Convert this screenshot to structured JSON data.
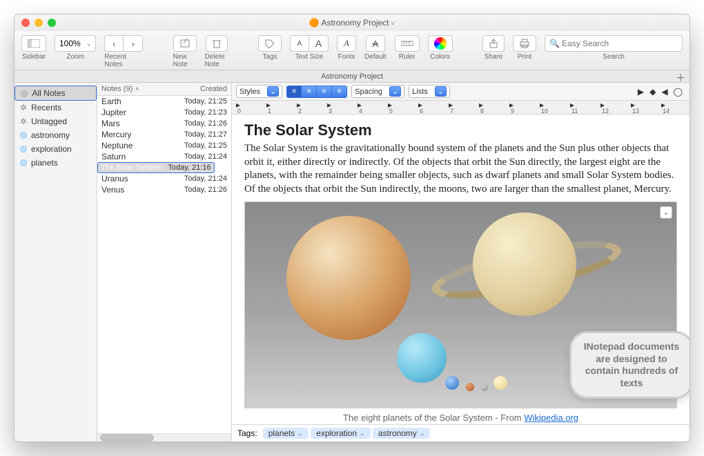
{
  "window": {
    "title": "Astronomy Project"
  },
  "toolbar": {
    "sidebar": "Sidebar",
    "zoom_label": "Zoom",
    "zoom_value": "100%",
    "recent": "Recent Notes",
    "new": "New Note",
    "delete": "Delete Note",
    "tags": "Tags",
    "textsize": "Text Size",
    "fonts": "Fonts",
    "default": "Default",
    "ruler": "Ruler",
    "colors": "Colors",
    "share": "Share",
    "print": "Print",
    "search_label": "Search",
    "search_placeholder": "Easy Search"
  },
  "docbar": {
    "title": "Astronomy Project"
  },
  "sidebar": {
    "items": [
      {
        "label": "All Notes"
      },
      {
        "label": "Recents"
      },
      {
        "label": "Untagged"
      },
      {
        "label": "astronomy"
      },
      {
        "label": "exploration"
      },
      {
        "label": "planets"
      }
    ]
  },
  "noteslist": {
    "header_notes": "Notes (9)",
    "header_created": "Created",
    "rows": [
      {
        "title": "Earth",
        "date": "Today, 21:25"
      },
      {
        "title": "Jupiter",
        "date": "Today, 21:23"
      },
      {
        "title": "Mars",
        "date": "Today, 21:26"
      },
      {
        "title": "Mercury",
        "date": "Today, 21:27"
      },
      {
        "title": "Neptune",
        "date": "Today, 21:25"
      },
      {
        "title": "Saturn",
        "date": "Today, 21:24"
      },
      {
        "title": "The Solar System",
        "date": "Today, 21:16"
      },
      {
        "title": "Uranus",
        "date": "Today, 21:24"
      },
      {
        "title": "Venus",
        "date": "Today, 21:26"
      }
    ],
    "selected_index": 6
  },
  "fmtbar": {
    "styles": "Styles",
    "spacing": "Spacing",
    "lists": "Lists"
  },
  "note": {
    "heading": "The Solar System",
    "body": "The Solar System is the gravitationally bound system of the planets and the Sun plus other objects that orbit it, either directly or indirectly. Of the objects that orbit the Sun directly, the largest eight are the planets, with the remainder being smaller objects, such as dwarf planets and small Solar System bodies. Of the objects that orbit the Sun indirectly, the moons, two are larger than the smallest planet, Mercury.",
    "caption_pre": "The eight planets of the Solar System - From ",
    "caption_link": "Wikipedia.org"
  },
  "tagsbar": {
    "label": "Tags:",
    "tags": [
      "planets",
      "exploration",
      "astronomy"
    ]
  },
  "callout": "INotepad documents are designed to contain hundreds of texts"
}
